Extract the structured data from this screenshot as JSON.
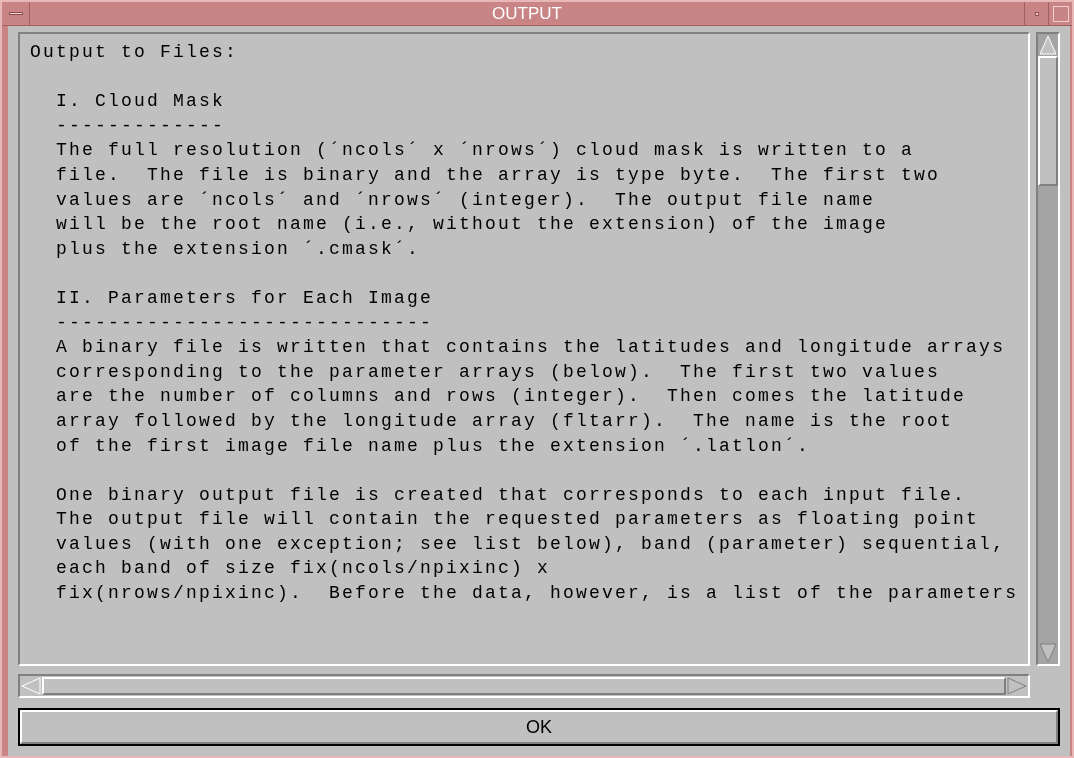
{
  "window": {
    "title": "OUTPUT"
  },
  "text": {
    "heading": "Output to Files:",
    "sections": [
      {
        "title": "I. Cloud Mask",
        "rule": "-------------",
        "paragraphs": [
          [
            "The full resolution (´ncols´ x ´nrows´) cloud mask is written to a",
            "file.  The file is binary and the array is type byte.  The first two",
            "values are ´ncols´ and ´nrows´ (integer).  The output file name",
            "will be the root name (i.e., without the extension) of the image",
            "plus the extension ´.cmask´."
          ]
        ]
      },
      {
        "title": "II. Parameters for Each Image",
        "rule": "-----------------------------",
        "paragraphs": [
          [
            "A binary file is written that contains the latitudes and longitude arrays",
            "corresponding to the parameter arrays (below).  The first two values",
            "are the number of columns and rows (integer).  Then comes the latitude",
            "array followed by the longitude array (fltarr).  The name is the root",
            "of the first image file name plus the extension ´.latlon´."
          ],
          [
            "One binary output file is created that corresponds to each input file.",
            "The output file will contain the requested parameters as floating point",
            "values (with one exception; see list below), band (parameter) sequential,",
            "each band of size fix(ncols/npixinc) x",
            "fix(nrows/npixinc).  Before the data, however, is a list of the parameters"
          ]
        ]
      }
    ]
  },
  "buttons": [
    {
      "label": "OK"
    }
  ]
}
